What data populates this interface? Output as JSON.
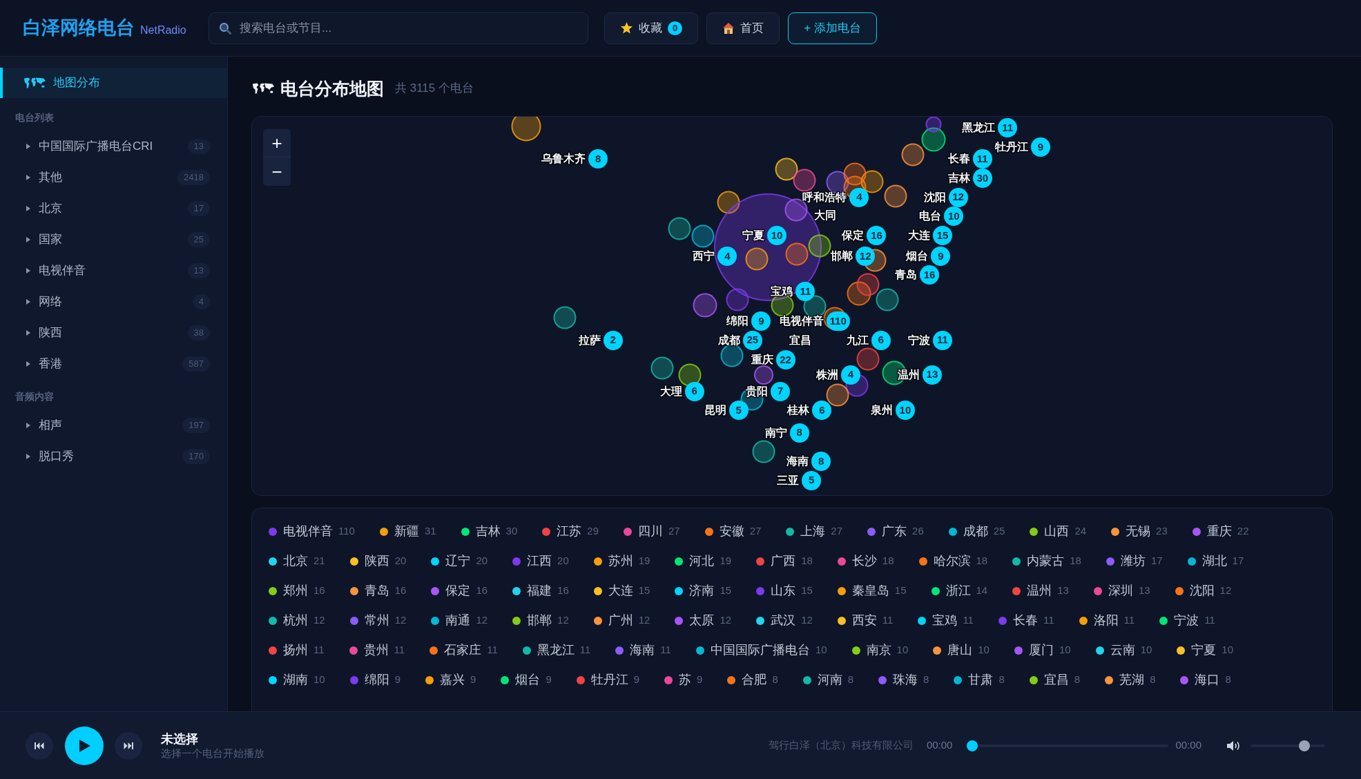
{
  "header": {
    "logo": "白泽网络电台",
    "logo_sub": "NetRadio",
    "search": {
      "placeholder": "搜索电台或节目..."
    },
    "buttons": [
      {
        "kind": "favorites",
        "label": "收藏",
        "count": "0"
      },
      {
        "kind": "home",
        "label": "首页"
      },
      {
        "kind": "add",
        "label": "+ 添加电台"
      }
    ]
  },
  "sidebar": {
    "top_item": {
      "label": "地图分布",
      "selected": true
    },
    "sections": [
      {
        "title": "电台列表",
        "items": [
          {
            "label": "中国国际广播电台CRI",
            "count": "13",
            "selected": false
          },
          {
            "label": "其他",
            "count": "2418",
            "selected": false
          },
          {
            "label": "北京",
            "count": "17",
            "selected": false
          },
          {
            "label": "国家",
            "count": "25",
            "selected": false
          },
          {
            "label": "电视伴音",
            "count": "13",
            "selected": false
          },
          {
            "label": "网络",
            "count": "4",
            "selected": false
          },
          {
            "label": "陕西",
            "count": "38",
            "selected": false
          },
          {
            "label": "香港",
            "count": "587",
            "selected": false
          }
        ]
      },
      {
        "title": "音频内容",
        "items": [
          {
            "label": "相声",
            "count": "197",
            "selected": false
          },
          {
            "label": "脱口秀",
            "count": "170",
            "selected": false
          }
        ]
      }
    ]
  },
  "page": {
    "title": "电台分布地图",
    "subtitle": "共 3115 个电台"
  },
  "map": {
    "zoom_in": "+",
    "zoom_out": "−",
    "markers": [
      {
        "label": "黑龙江",
        "count": "11"
      },
      {
        "label": "牡丹江",
        "count": "9"
      },
      {
        "label": "乌鲁木齐",
        "count": "8"
      },
      {
        "label": "长春",
        "count": "11"
      },
      {
        "label": "吉林",
        "count": "30"
      },
      {
        "label": "呼和浩特",
        "count": "4"
      },
      {
        "label": "沈阳",
        "count": "12"
      },
      {
        "label": "大同"
      },
      {
        "label": "电台",
        "count": "10"
      },
      {
        "label": "宁夏",
        "count": "10"
      },
      {
        "label": "保定",
        "count": "16"
      },
      {
        "label": "大连",
        "count": "15"
      },
      {
        "label": "西宁",
        "count": "4"
      },
      {
        "label": "邯郸",
        "count": "12"
      },
      {
        "label": "烟台",
        "count": "9"
      },
      {
        "label": "青岛",
        "count": "16"
      },
      {
        "label": "宝鸡",
        "count": "11"
      },
      {
        "label": "绵阳",
        "count": "9"
      },
      {
        "label": "电视伴音",
        "count": "110"
      },
      {
        "label": "拉萨",
        "count": "2"
      },
      {
        "label": "成都",
        "count": "25"
      },
      {
        "label": "宜昌"
      },
      {
        "label": "九江",
        "count": "6"
      },
      {
        "label": "宁波",
        "count": "11"
      },
      {
        "label": "重庆",
        "count": "22"
      },
      {
        "label": "株洲",
        "count": "4"
      },
      {
        "label": "温州",
        "count": "13"
      },
      {
        "label": "大理",
        "count": "6"
      },
      {
        "label": "贵阳",
        "count": "7"
      },
      {
        "label": "昆明",
        "count": "5"
      },
      {
        "label": "桂林",
        "count": "6"
      },
      {
        "label": "泉州",
        "count": "10"
      },
      {
        "label": "南宁",
        "count": "8"
      },
      {
        "label": "海南",
        "count": "8"
      },
      {
        "label": "三亚",
        "count": "5"
      }
    ]
  },
  "legend": [
    {
      "label": "电视伴音",
      "count": "110",
      "color": "#7c3aed"
    },
    {
      "label": "新疆",
      "count": "31",
      "color": "#f59e0b"
    },
    {
      "label": "吉林",
      "count": "30",
      "color": "#00e676"
    },
    {
      "label": "江苏",
      "count": "29",
      "color": "#ef4444"
    },
    {
      "label": "四川",
      "count": "27",
      "color": "#ec4899"
    },
    {
      "label": "安徽",
      "count": "27",
      "color": "#f97316"
    },
    {
      "label": "上海",
      "count": "27",
      "color": "#14b8a6"
    },
    {
      "label": "广东",
      "count": "26",
      "color": "#8b5cf6"
    },
    {
      "label": "成都",
      "count": "25",
      "color": "#06b6d4"
    },
    {
      "label": "山西",
      "count": "24",
      "color": "#84cc16"
    },
    {
      "label": "无锡",
      "count": "23",
      "color": "#fb923c"
    },
    {
      "label": "重庆",
      "count": "22",
      "color": "#a855f7"
    },
    {
      "label": "北京",
      "count": "21",
      "color": "#22d3ee"
    },
    {
      "label": "陕西",
      "count": "20",
      "color": "#fbbf24"
    },
    {
      "label": "辽宁",
      "count": "20",
      "color": "#00d4ff"
    },
    {
      "label": "江西",
      "count": "20",
      "color": "#7c3aed"
    },
    {
      "label": "苏州",
      "count": "19",
      "color": "#f59e0b"
    },
    {
      "label": "河北",
      "count": "19",
      "color": "#00e676"
    },
    {
      "label": "广西",
      "count": "18",
      "color": "#ef4444"
    },
    {
      "label": "长沙",
      "count": "18",
      "color": "#ec4899"
    },
    {
      "label": "哈尔滨",
      "count": "18",
      "color": "#f97316"
    },
    {
      "label": "内蒙古",
      "count": "18",
      "color": "#14b8a6"
    },
    {
      "label": "潍坊",
      "count": "17",
      "color": "#8b5cf6"
    },
    {
      "label": "湖北",
      "count": "17",
      "color": "#06b6d4"
    },
    {
      "label": "郑州",
      "count": "16",
      "color": "#84cc16"
    },
    {
      "label": "青岛",
      "count": "16",
      "color": "#fb923c"
    },
    {
      "label": "保定",
      "count": "16",
      "color": "#a855f7"
    },
    {
      "label": "福建",
      "count": "16",
      "color": "#22d3ee"
    },
    {
      "label": "大连",
      "count": "15",
      "color": "#fbbf24"
    },
    {
      "label": "济南",
      "count": "15",
      "color": "#00d4ff"
    },
    {
      "label": "山东",
      "count": "15",
      "color": "#7c3aed"
    },
    {
      "label": "秦皇岛",
      "count": "15",
      "color": "#f59e0b"
    },
    {
      "label": "浙江",
      "count": "14",
      "color": "#00e676"
    },
    {
      "label": "温州",
      "count": "13",
      "color": "#ef4444"
    },
    {
      "label": "深圳",
      "count": "13",
      "color": "#ec4899"
    },
    {
      "label": "沈阳",
      "count": "12",
      "color": "#f97316"
    },
    {
      "label": "杭州",
      "count": "12",
      "color": "#14b8a6"
    },
    {
      "label": "常州",
      "count": "12",
      "color": "#8b5cf6"
    },
    {
      "label": "南通",
      "count": "12",
      "color": "#06b6d4"
    },
    {
      "label": "邯郸",
      "count": "12",
      "color": "#84cc16"
    },
    {
      "label": "广州",
      "count": "12",
      "color": "#fb923c"
    },
    {
      "label": "太原",
      "count": "12",
      "color": "#a855f7"
    },
    {
      "label": "武汉",
      "count": "12",
      "color": "#22d3ee"
    },
    {
      "label": "西安",
      "count": "11",
      "color": "#fbbf24"
    },
    {
      "label": "宝鸡",
      "count": "11",
      "color": "#00d4ff"
    },
    {
      "label": "长春",
      "count": "11",
      "color": "#7c3aed"
    },
    {
      "label": "洛阳",
      "count": "11",
      "color": "#f59e0b"
    },
    {
      "label": "宁波",
      "count": "11",
      "color": "#00e676"
    },
    {
      "label": "扬州",
      "count": "11",
      "color": "#ef4444"
    },
    {
      "label": "贵州",
      "count": "11",
      "color": "#ec4899"
    },
    {
      "label": "石家庄",
      "count": "11",
      "color": "#f97316"
    },
    {
      "label": "黑龙江",
      "count": "11",
      "color": "#14b8a6"
    },
    {
      "label": "海南",
      "count": "11",
      "color": "#8b5cf6"
    },
    {
      "label": "中国国际广播电台",
      "count": "10",
      "color": "#06b6d4"
    },
    {
      "label": "南京",
      "count": "10",
      "color": "#84cc16"
    },
    {
      "label": "唐山",
      "count": "10",
      "color": "#fb923c"
    },
    {
      "label": "厦门",
      "count": "10",
      "color": "#a855f7"
    },
    {
      "label": "云南",
      "count": "10",
      "color": "#22d3ee"
    },
    {
      "label": "宁夏",
      "count": "10",
      "color": "#fbbf24"
    },
    {
      "label": "湖南",
      "count": "10",
      "color": "#00d4ff"
    },
    {
      "label": "绵阳",
      "count": "9",
      "color": "#7c3aed"
    },
    {
      "label": "嘉兴",
      "count": "9",
      "color": "#f59e0b"
    },
    {
      "label": "烟台",
      "count": "9",
      "color": "#00e676"
    },
    {
      "label": "牡丹江",
      "count": "9",
      "color": "#ef4444"
    },
    {
      "label": "苏",
      "count": "9",
      "color": "#ec4899"
    },
    {
      "label": "合肥",
      "count": "8",
      "color": "#f97316"
    },
    {
      "label": "河南",
      "count": "8",
      "color": "#14b8a6"
    },
    {
      "label": "珠海",
      "count": "8",
      "color": "#8b5cf6"
    },
    {
      "label": "甘肃",
      "count": "8",
      "color": "#06b6d4"
    },
    {
      "label": "宜昌",
      "count": "8",
      "color": "#84cc16"
    },
    {
      "label": "芜湖",
      "count": "8",
      "color": "#fb923c"
    },
    {
      "label": "海口",
      "count": "8",
      "color": "#a855f7"
    }
  ],
  "player": {
    "playing": false,
    "title": "未选择",
    "subtitle": "选择一个电台开始播放",
    "company": "驾行白泽（北京）科技有限公司",
    "elapsed": "00:00",
    "duration": "00:00",
    "progress": {
      "level": 0
    },
    "volume": {
      "level": 0.76
    }
  }
}
